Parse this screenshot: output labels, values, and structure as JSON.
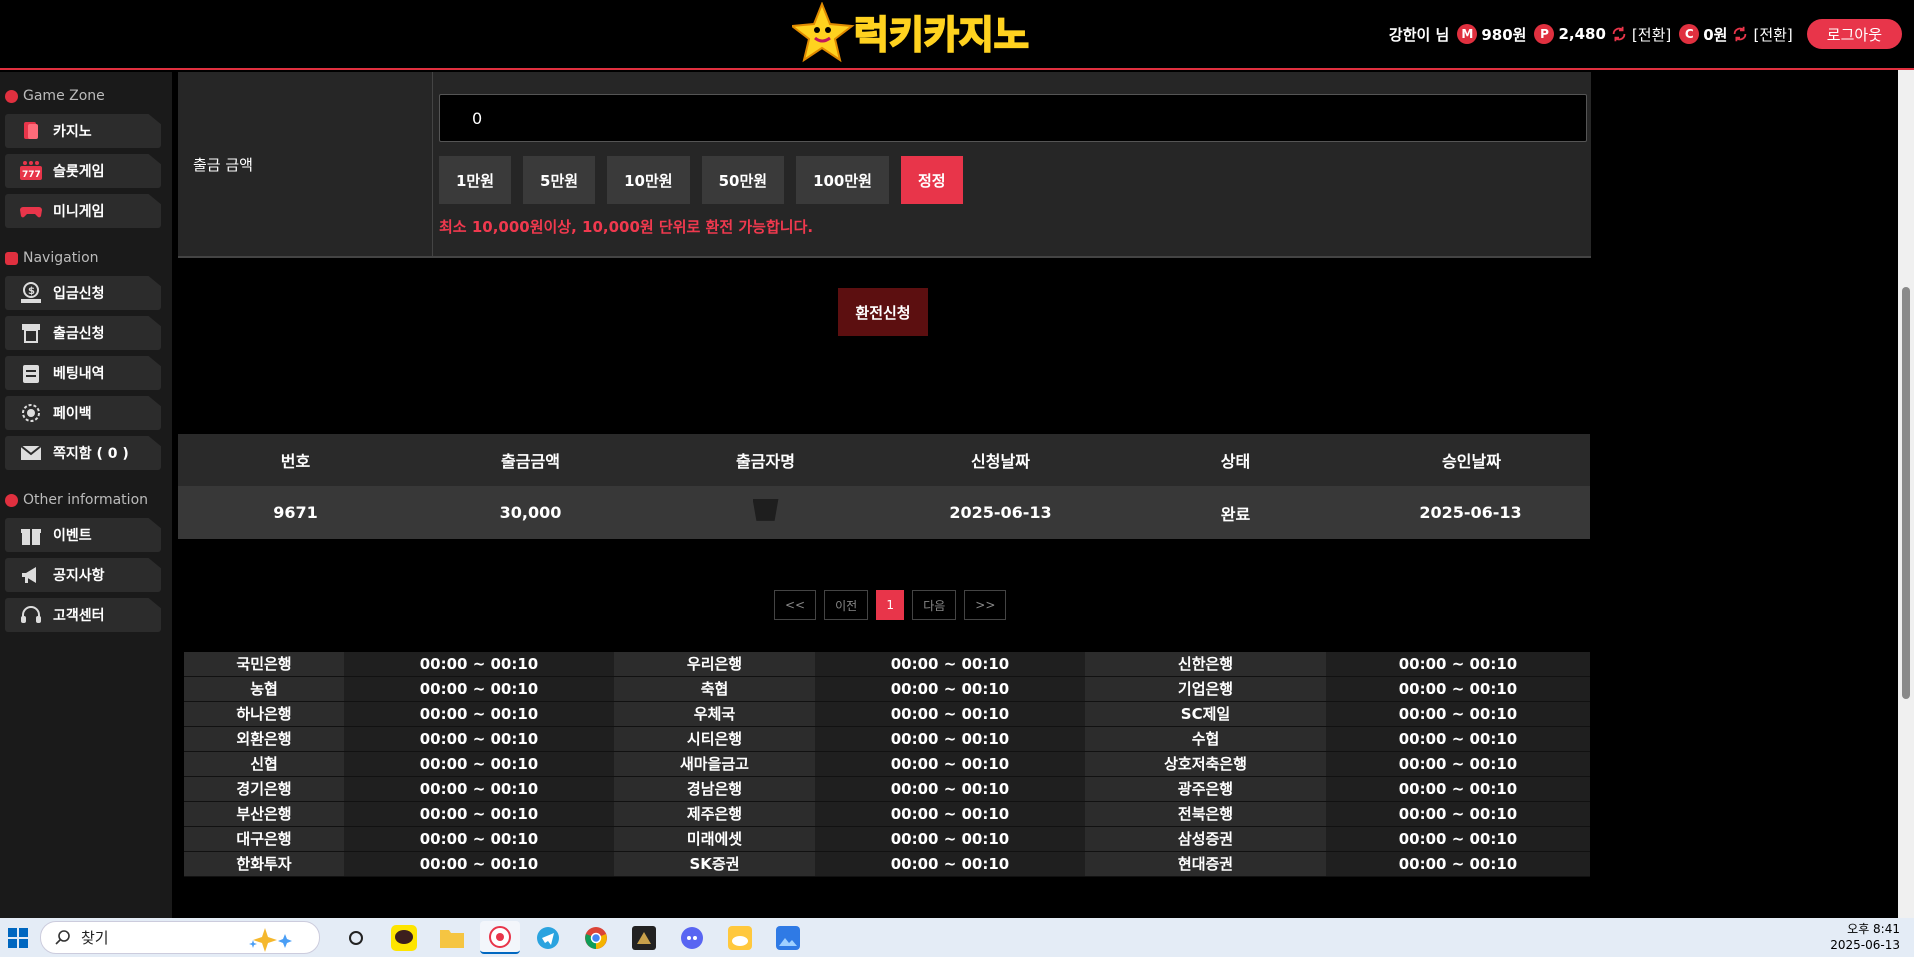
{
  "header": {
    "logo_text": "럭키카지노",
    "username": "강한이 님",
    "money_badge": "M",
    "money": "980원",
    "point_badge": "P",
    "point": "2,480",
    "point_swap": "[전환]",
    "coin_badge": "C",
    "coin": "0원",
    "coin_swap": "[전환]",
    "logout": "로그아웃"
  },
  "sidebar": {
    "sections": [
      {
        "title": "Game Zone",
        "items": [
          {
            "label": "카지노"
          },
          {
            "label": "슬롯게임"
          },
          {
            "label": "미니게임"
          }
        ]
      },
      {
        "title": "Navigation",
        "items": [
          {
            "label": "입금신청"
          },
          {
            "label": "출금신청"
          },
          {
            "label": "베팅내역"
          },
          {
            "label": "페이백"
          },
          {
            "label": "쪽지함 ( 0 )"
          }
        ]
      },
      {
        "title": "Other information",
        "items": [
          {
            "label": "이벤트"
          },
          {
            "label": "공지사항"
          },
          {
            "label": "고객센터"
          }
        ]
      }
    ]
  },
  "form": {
    "label": "출금 금액",
    "amount_value": "0",
    "chips": [
      "1만원",
      "5만원",
      "10만원",
      "50만원",
      "100만원"
    ],
    "reset": "정정",
    "notice": "최소 10,000원이상, 10,000원 단위로 환전 가능합니다.",
    "submit": "환전신청"
  },
  "history": {
    "columns": [
      "번호",
      "출금금액",
      "출금자명",
      "신청날짜",
      "상태",
      "승인날짜"
    ],
    "rows": [
      {
        "no": "9671",
        "amount": "30,000",
        "name": "",
        "requested": "2025-06-13",
        "status": "완료",
        "approved": "2025-06-13"
      }
    ]
  },
  "pager": {
    "first": "<<",
    "prev": "이전",
    "current": "1",
    "next": "다음",
    "last": ">>"
  },
  "banks": [
    [
      "국민은행",
      "00:00 ~ 00:10",
      "우리은행",
      "00:00 ~ 00:10",
      "신한은행",
      "00:00 ~ 00:10"
    ],
    [
      "농협",
      "00:00 ~ 00:10",
      "축협",
      "00:00 ~ 00:10",
      "기업은행",
      "00:00 ~ 00:10"
    ],
    [
      "하나은행",
      "00:00 ~ 00:10",
      "우체국",
      "00:00 ~ 00:10",
      "SC제일",
      "00:00 ~ 00:10"
    ],
    [
      "외환은행",
      "00:00 ~ 00:10",
      "시티은행",
      "00:00 ~ 00:10",
      "수협",
      "00:00 ~ 00:10"
    ],
    [
      "신협",
      "00:00 ~ 00:10",
      "새마을금고",
      "00:00 ~ 00:10",
      "상호저축은행",
      "00:00 ~ 00:10"
    ],
    [
      "경기은행",
      "00:00 ~ 00:10",
      "경남은행",
      "00:00 ~ 00:10",
      "광주은행",
      "00:00 ~ 00:10"
    ],
    [
      "부산은행",
      "00:00 ~ 00:10",
      "제주은행",
      "00:00 ~ 00:10",
      "전북은행",
      "00:00 ~ 00:10"
    ],
    [
      "대구은행",
      "00:00 ~ 00:10",
      "미래에셋",
      "00:00 ~ 00:10",
      "삼성증권",
      "00:00 ~ 00:10"
    ],
    [
      "한화투자",
      "00:00 ~ 00:10",
      "SK증권",
      "00:00 ~ 00:10",
      "현대증권",
      "00:00 ~ 00:10"
    ]
  ],
  "taskbar": {
    "search_placeholder": "찾기",
    "time": "오후 8:41",
    "date": "2025-06-13"
  },
  "colors": {
    "accent": "#e8354a",
    "submit": "#5c0f10",
    "panel": "#262626"
  }
}
